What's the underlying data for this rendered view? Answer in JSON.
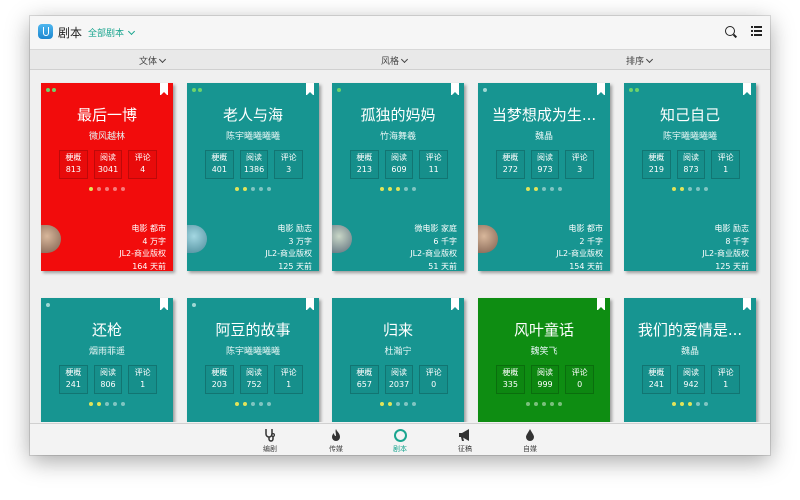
{
  "header": {
    "app_title": "剧本",
    "scope_label": "全部剧本"
  },
  "filters": [
    {
      "label": "文体"
    },
    {
      "label": "风格"
    },
    {
      "label": "排序"
    }
  ],
  "stat_labels": {
    "outline": "梗概",
    "reads": "阅读",
    "comments": "评论"
  },
  "colors": {
    "teal": "#179591",
    "red": "#f20c0c",
    "green": "#0e8d12",
    "accent": "#1aa58f"
  },
  "cards": [
    {
      "title": "最后一博",
      "author": "微风越林",
      "outline": "813",
      "reads": "3041",
      "comments": "4",
      "genre": "电影 都市",
      "words": "4 万字",
      "rights": "JL2-商业版权",
      "age": "164 天前"
    },
    {
      "title": "老人与海",
      "author": "陈宇曦曦曦曦",
      "outline": "401",
      "reads": "1386",
      "comments": "3",
      "genre": "电影 励志",
      "words": "3 万字",
      "rights": "JL2-商业版权",
      "age": "125 天前"
    },
    {
      "title": "孤独的妈妈",
      "author": "竹海舞羲",
      "outline": "213",
      "reads": "609",
      "comments": "11",
      "genre": "微电影 家庭",
      "words": "6 千字",
      "rights": "JL2-商业版权",
      "age": "51 天前"
    },
    {
      "title": "当梦想成为生...",
      "author": "魏晶",
      "outline": "272",
      "reads": "973",
      "comments": "3",
      "genre": "电影 都市",
      "words": "2 千字",
      "rights": "JL2-商业版权",
      "age": "154 天前"
    },
    {
      "title": "知己自己",
      "author": "陈宇曦曦曦曦",
      "outline": "219",
      "reads": "873",
      "comments": "1",
      "genre": "电影 励志",
      "words": "8 千字",
      "rights": "JL2-商业版权",
      "age": "125 天前"
    },
    {
      "title": "还枪",
      "author": "烟雨菲遥",
      "outline": "241",
      "reads": "806",
      "comments": "1"
    },
    {
      "title": "阿豆的故事",
      "author": "陈宇曦曦曦曦",
      "outline": "203",
      "reads": "752",
      "comments": "1"
    },
    {
      "title": "归来",
      "author": "杜瀚宁",
      "outline": "657",
      "reads": "2037",
      "comments": "0"
    },
    {
      "title": "风叶童话",
      "author": "魏笑飞",
      "outline": "335",
      "reads": "999",
      "comments": "0"
    },
    {
      "title": "我们的爱情是...",
      "author": "魏晶",
      "outline": "241",
      "reads": "942",
      "comments": "1"
    }
  ],
  "bottom_nav": [
    {
      "label": "编剧"
    },
    {
      "label": "传媒"
    },
    {
      "label": "剧本"
    },
    {
      "label": "征稿"
    },
    {
      "label": "自媒"
    }
  ]
}
